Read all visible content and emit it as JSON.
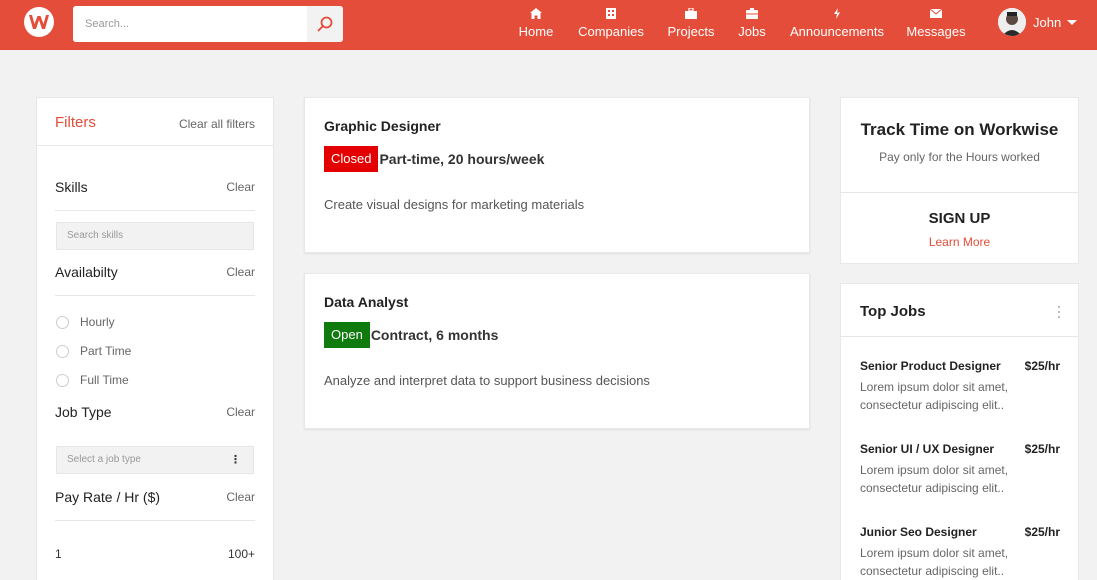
{
  "header": {
    "search_placeholder": "Search...",
    "nav": [
      {
        "label": "Home",
        "icon": "home-icon"
      },
      {
        "label": "Companies",
        "icon": "building-icon"
      },
      {
        "label": "Projects",
        "icon": "briefcase-icon"
      },
      {
        "label": "Jobs",
        "icon": "jobs-icon"
      },
      {
        "label": "Announcements",
        "icon": "lightning-icon"
      },
      {
        "label": "Messages",
        "icon": "envelope-icon"
      }
    ],
    "user_name": "John",
    "brand_color": "#e44d3a"
  },
  "filters": {
    "title": "Filters",
    "clear_all": "Clear all filters",
    "skills": {
      "label": "Skills",
      "clear": "Clear",
      "placeholder": "Search skills"
    },
    "availability": {
      "label": "Availabilty",
      "clear": "Clear",
      "options": [
        "Hourly",
        "Part Time",
        "Full Time"
      ]
    },
    "job_type": {
      "label": "Job Type",
      "clear": "Clear",
      "placeholder": "Select a job type"
    },
    "pay_rate": {
      "label": "Pay Rate / Hr ($)",
      "clear": "Clear",
      "min": "1",
      "max": "100+"
    }
  },
  "jobs": [
    {
      "title": "Graphic Designer",
      "status": "Closed",
      "type": "Part-time, 20 hours/week",
      "description": "Create visual designs for marketing materials"
    },
    {
      "title": "Data Analyst",
      "status": "Open",
      "type": "Contract, 6 months",
      "description": "Analyze and interpret data to support business decisions"
    }
  ],
  "track": {
    "title": "Track Time on Workwise",
    "subtitle": "Pay only for the Hours worked",
    "signup": "SIGN UP",
    "learn_more": "Learn More"
  },
  "top_jobs": {
    "title": "Top Jobs",
    "items": [
      {
        "name": "Senior Product Designer",
        "rate": "$25/hr",
        "description": "Lorem ipsum dolor sit amet, consectetur adipiscing elit.."
      },
      {
        "name": "Senior UI / UX Designer",
        "rate": "$25/hr",
        "description": "Lorem ipsum dolor sit amet, consectetur adipiscing elit.."
      },
      {
        "name": "Junior Seo Designer",
        "rate": "$25/hr",
        "description": "Lorem ipsum dolor sit amet, consectetur adipiscing elit.."
      }
    ]
  }
}
